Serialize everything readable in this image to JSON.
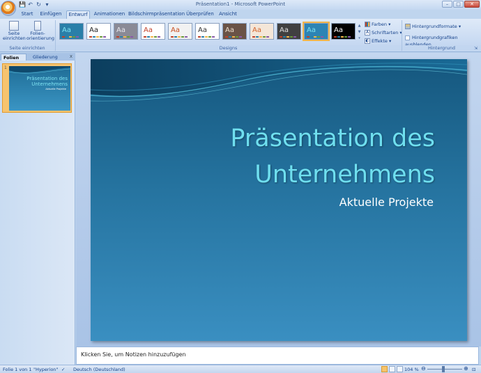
{
  "window": {
    "title": "Präsentation1 - Microsoft PowerPoint",
    "controls": {
      "minimize": "–",
      "maximize": "□",
      "close": "✕"
    }
  },
  "quick_access": {
    "save": "💾",
    "undo": "↶",
    "redo": "↻",
    "more": "▾"
  },
  "tabs": [
    "Start",
    "Einfügen",
    "Entwurf",
    "Animationen",
    "Bildschirmpräsentation",
    "Überprüfen",
    "Ansicht"
  ],
  "active_tab": "Entwurf",
  "ribbon": {
    "page_setup": {
      "seite_einrichten": "Seite einrichten",
      "folienorientierung": "Folien-orientierung",
      "group_label": "Seite einrichten"
    },
    "designs": {
      "themes": [
        {
          "label": "Aa",
          "bg": "#2a7fa8",
          "fg": "#7fe3f2",
          "selected": false
        },
        {
          "label": "Aa",
          "bg": "#ffffff",
          "fg": "#222222",
          "selected": false
        },
        {
          "label": "Aa",
          "bg": "#8a8a96",
          "fg": "#e8e8ee",
          "selected": false
        },
        {
          "label": "Aa",
          "bg": "#ffffff",
          "fg": "#c0412a",
          "selected": false
        },
        {
          "label": "Aa",
          "bg": "#f2f2f2",
          "fg": "#c84c1c",
          "selected": false
        },
        {
          "label": "Aa",
          "bg": "#ffffff",
          "fg": "#333333",
          "selected": false
        },
        {
          "label": "Aa",
          "bg": "#6a5346",
          "fg": "#f0e2d0",
          "selected": false
        },
        {
          "label": "Aa",
          "bg": "#f4e6d8",
          "fg": "#d2642c",
          "selected": false
        },
        {
          "label": "Aa",
          "bg": "#404040",
          "fg": "#e0e0e0",
          "selected": false
        },
        {
          "label": "Aa",
          "bg": "#2d84b4",
          "fg": "#7fe3f2",
          "selected": true
        },
        {
          "label": "Aa",
          "bg": "#000000",
          "fg": "#ffffff",
          "selected": false
        }
      ],
      "farben": "Farben",
      "schriftarten": "Schriftarten",
      "effekte": "Effekte",
      "group_label": "Designs"
    },
    "hintergrund": {
      "hintergrundformate": "Hintergrundformate",
      "hintergrundgrafiken": "Hintergrundgrafiken ausblenden",
      "group_label": "Hintergrund"
    }
  },
  "left_pane": {
    "tab_folien": "Folien",
    "tab_gliederung": "Gliederung",
    "close": "x",
    "thumbnail": {
      "number": "1",
      "title": "Präsentation des Unternehmens",
      "subtitle": "Aktuelle Projekte"
    }
  },
  "slide": {
    "title": "Präsentation des Unternehmens",
    "subtitle": "Aktuelle Projekte"
  },
  "notes": {
    "placeholder": "Klicken Sie, um Notizen hinzuzufügen"
  },
  "statusbar": {
    "slide_info": "Folie 1 von 1",
    "theme": "\"Hyperion\"",
    "language": "Deutsch (Deutschland)",
    "zoom": "104 %"
  },
  "colors": {
    "ribbon_bg": "#dfeaf8",
    "slide_title": "#6fdfef",
    "slide_bg_top": "#15577e",
    "slide_bg_bottom": "#3a8fc1",
    "accent": "#f2b54a"
  }
}
